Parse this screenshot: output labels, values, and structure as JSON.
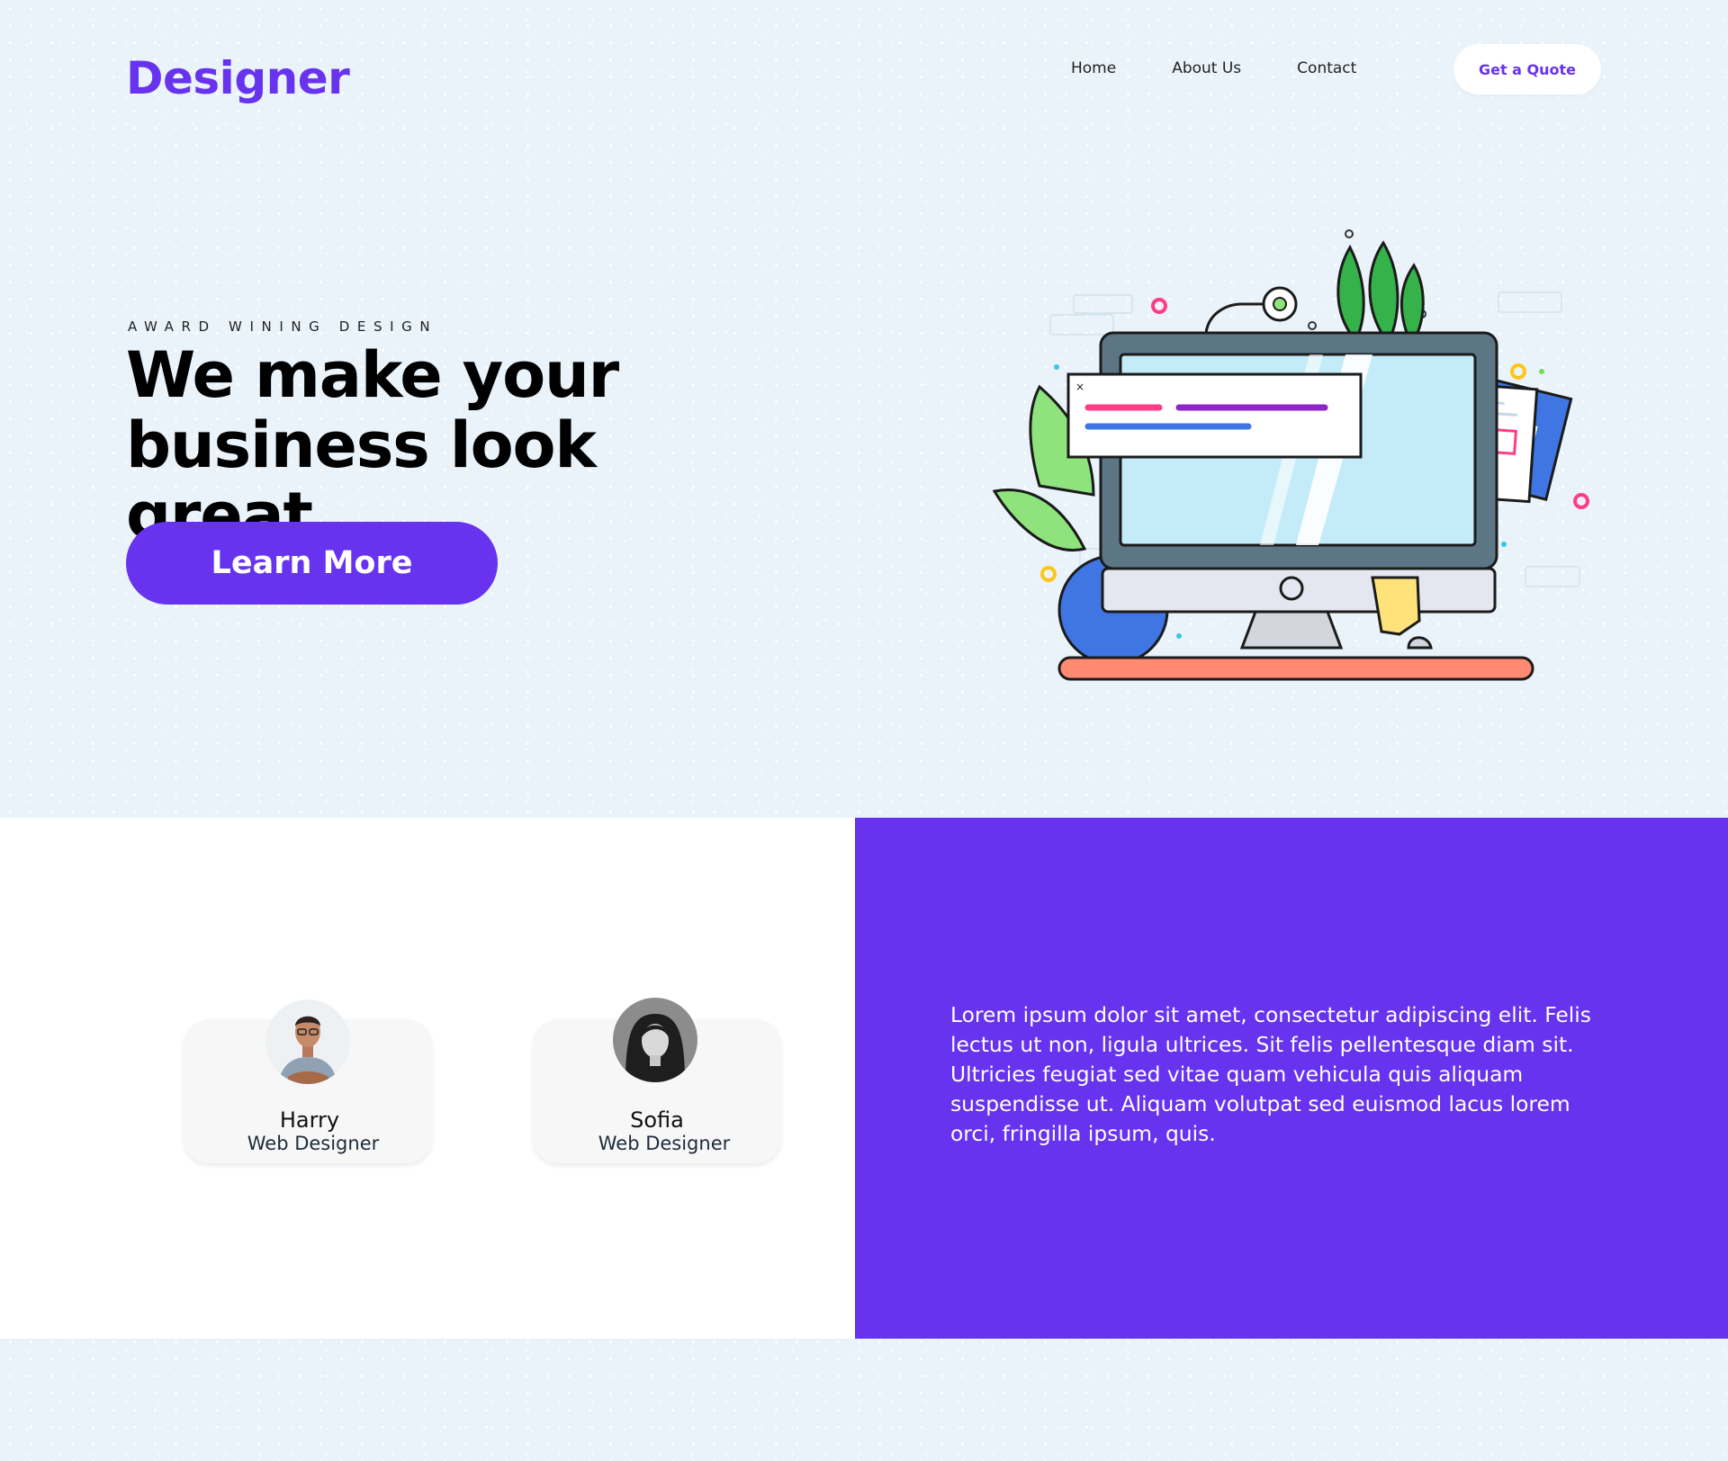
{
  "header": {
    "logo": "Designer",
    "nav": [
      "Home",
      "About Us",
      "Contact"
    ],
    "cta": "Get a Quote"
  },
  "hero": {
    "eyebrow": "AWARD WINING DESIGN",
    "headline_line1": "We make your",
    "headline_line2": "business look great",
    "button": "Learn More",
    "illustration": "desktop-computer-illustration"
  },
  "team": [
    {
      "name": "Harry",
      "role": "Web Designer",
      "avatar": "man-portrait-avatar"
    },
    {
      "name": "Sofia",
      "role": "Web Designer",
      "avatar": "woman-portrait-avatar"
    }
  ],
  "about": {
    "text": "Lorem ipsum dolor sit amet, consectetur adipiscing elit. Felis lectus ut non, ligula ultrices. Sit felis pellentesque diam sit. Ultricies feugiat sed vitae quam vehicula quis aliquam suspendisse ut. Aliquam volutpat sed euismod lacus lorem orci, fringilla ipsum, quis."
  },
  "colors": {
    "brand": "#6733ee",
    "background": "#eaf3fa",
    "text": "#000000"
  }
}
